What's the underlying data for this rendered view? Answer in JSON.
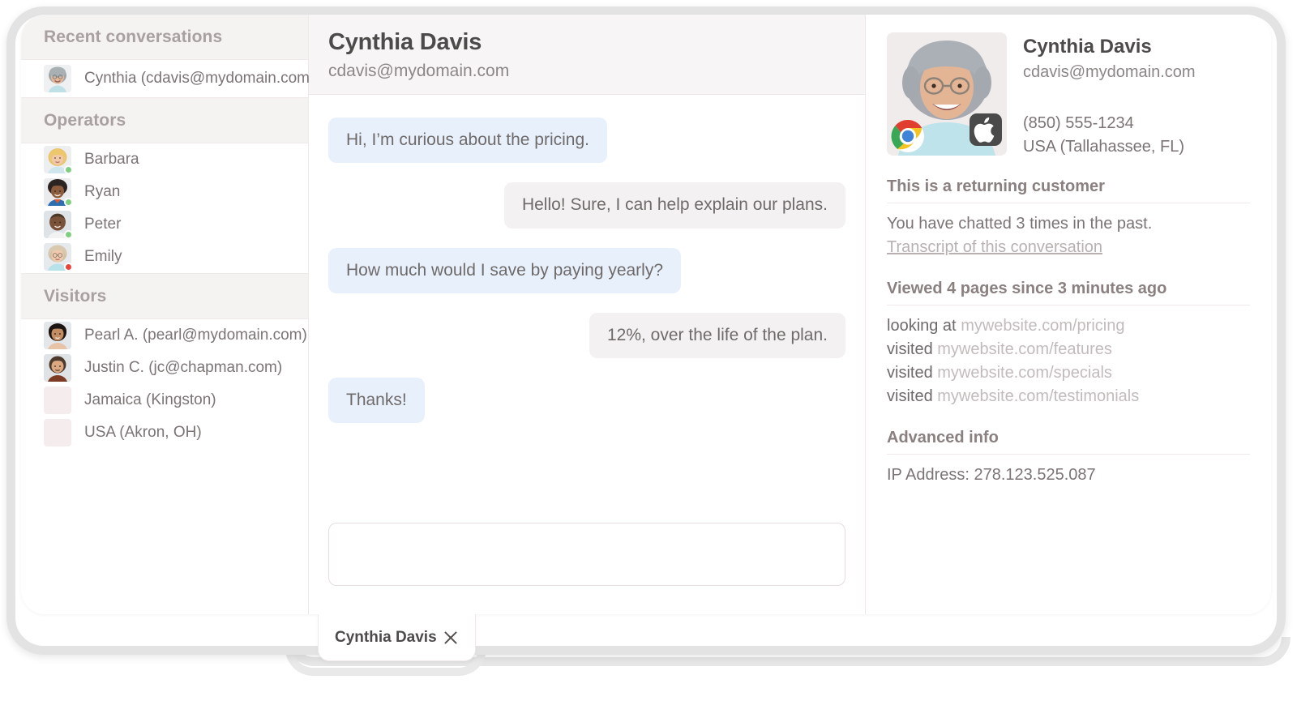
{
  "sidebar": {
    "sections": [
      {
        "title": "Recent conversations",
        "items": [
          {
            "label": "Cynthia (cdavis@mydomain.com)",
            "avatar": "cynthia",
            "status": ""
          }
        ]
      },
      {
        "title": "Operators",
        "items": [
          {
            "label": "Barbara",
            "avatar": "barbara",
            "status": "online"
          },
          {
            "label": "Ryan",
            "avatar": "ryan",
            "status": "online"
          },
          {
            "label": "Peter",
            "avatar": "peter",
            "status": "online"
          },
          {
            "label": "Emily",
            "avatar": "emily",
            "status": "busy"
          }
        ]
      },
      {
        "title": "Visitors",
        "items": [
          {
            "label": "Pearl A. (pearl@mydomain.com)",
            "avatar": "pearl",
            "status": ""
          },
          {
            "label": "Justin C. (jc@chapman.com)",
            "avatar": "justin",
            "status": ""
          },
          {
            "label": "Jamaica (Kingston)",
            "avatar": "blank",
            "status": ""
          },
          {
            "label": "USA (Akron, OH)",
            "avatar": "blank",
            "status": ""
          }
        ]
      }
    ]
  },
  "chat": {
    "title": "Cynthia Davis",
    "email": "cdavis@mydomain.com",
    "messages": [
      {
        "dir": "in",
        "text": "Hi, I’m curious about the pricing."
      },
      {
        "dir": "out",
        "text": "Hello! Sure, I can help explain our plans."
      },
      {
        "dir": "in",
        "text": "How much would I save by paying yearly?"
      },
      {
        "dir": "out",
        "text": "12%, over the life of the plan."
      },
      {
        "dir": "in",
        "text": "Thanks!"
      }
    ],
    "composer_value": "",
    "composer_placeholder": ""
  },
  "profile": {
    "name": "Cynthia Davis",
    "email": "cdavis@mydomain.com",
    "phone": "(850) 555-1234",
    "location": "USA (Tallahassee, FL)",
    "browser_icon": "chrome-icon",
    "os_icon": "apple-icon",
    "returning": {
      "title": "This is a returning customer",
      "line": "You have chatted 3 times in the past.",
      "link": "Transcript of this conversation"
    },
    "pages": {
      "title": "Viewed 4 pages since 3 minutes ago",
      "items": [
        {
          "verb": "looking at",
          "url": "mywebsite.com/pricing"
        },
        {
          "verb": "visited",
          "url": "mywebsite.com/features"
        },
        {
          "verb": "visited",
          "url": "mywebsite.com/specials"
        },
        {
          "verb": "visited",
          "url": "mywebsite.com/testimonials"
        }
      ]
    },
    "advanced": {
      "title": "Advanced info",
      "ip_label": "IP Address: 278.123.525.087"
    }
  },
  "tabbar": {
    "tabs": [
      {
        "label": "Cynthia Davis",
        "close_icon": "close-icon"
      }
    ]
  },
  "colors": {
    "bubble_in": "#e8f1fb",
    "bubble_out": "#f3f1f1",
    "status_online": "#7ed07e",
    "status_busy": "#e8453c",
    "header_band": "#f5f2f2"
  }
}
